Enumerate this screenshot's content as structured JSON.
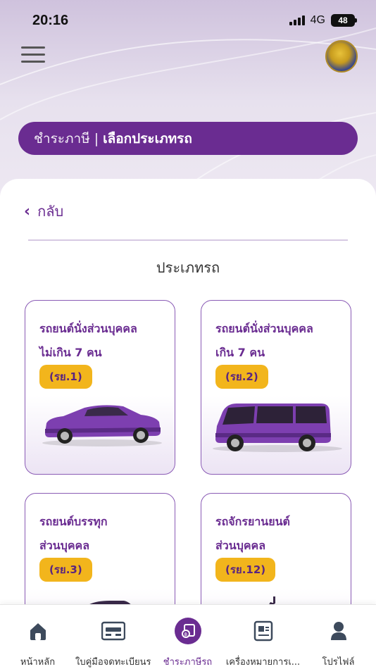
{
  "status_bar": {
    "time": "20:16",
    "network": "4G",
    "battery": "48"
  },
  "header": {
    "title_main": "ชำระภาษี",
    "title_separator": "|",
    "title_sub": "เลือกประเภทรถ"
  },
  "back": {
    "label": "กลับ"
  },
  "section": {
    "title": "ประเภทรถ"
  },
  "vehicle_types": [
    {
      "line1": "รถยนต์นั่งส่วนบุคคล",
      "line2": "ไม่เกิน 7 คน",
      "code": "(รย.1)",
      "image": "sedan-car"
    },
    {
      "line1": "รถยนต์นั่งส่วนบุคคล",
      "line2": "เกิน 7 คน",
      "code": "(รย.2)",
      "image": "van"
    },
    {
      "line1": "รถยนต์บรรทุก",
      "line2": "ส่วนบุคคล",
      "code": "(รย.3)",
      "image": "pickup-truck"
    },
    {
      "line1": "รถจักรยานยนต์",
      "line2": "ส่วนบุคคล",
      "code": "(รย.12)",
      "image": "motorcycle"
    }
  ],
  "bottom_nav": [
    {
      "label": "หน้าหลัก",
      "icon": "home-icon",
      "active": false
    },
    {
      "label": "ใบคู่มือจดทะเบียนรถ",
      "icon": "registration-book-icon",
      "active": false
    },
    {
      "label": "ชำระภาษีรถ",
      "icon": "tax-payment-icon",
      "active": true
    },
    {
      "label": "เครื่องหมายการเ...",
      "icon": "tax-sign-icon",
      "active": false
    },
    {
      "label": "โปรไฟล์",
      "icon": "profile-icon",
      "active": false
    }
  ],
  "colors": {
    "primary": "#6a2c91",
    "badge": "#f2b51c",
    "card_border": "#8a5bb5"
  }
}
